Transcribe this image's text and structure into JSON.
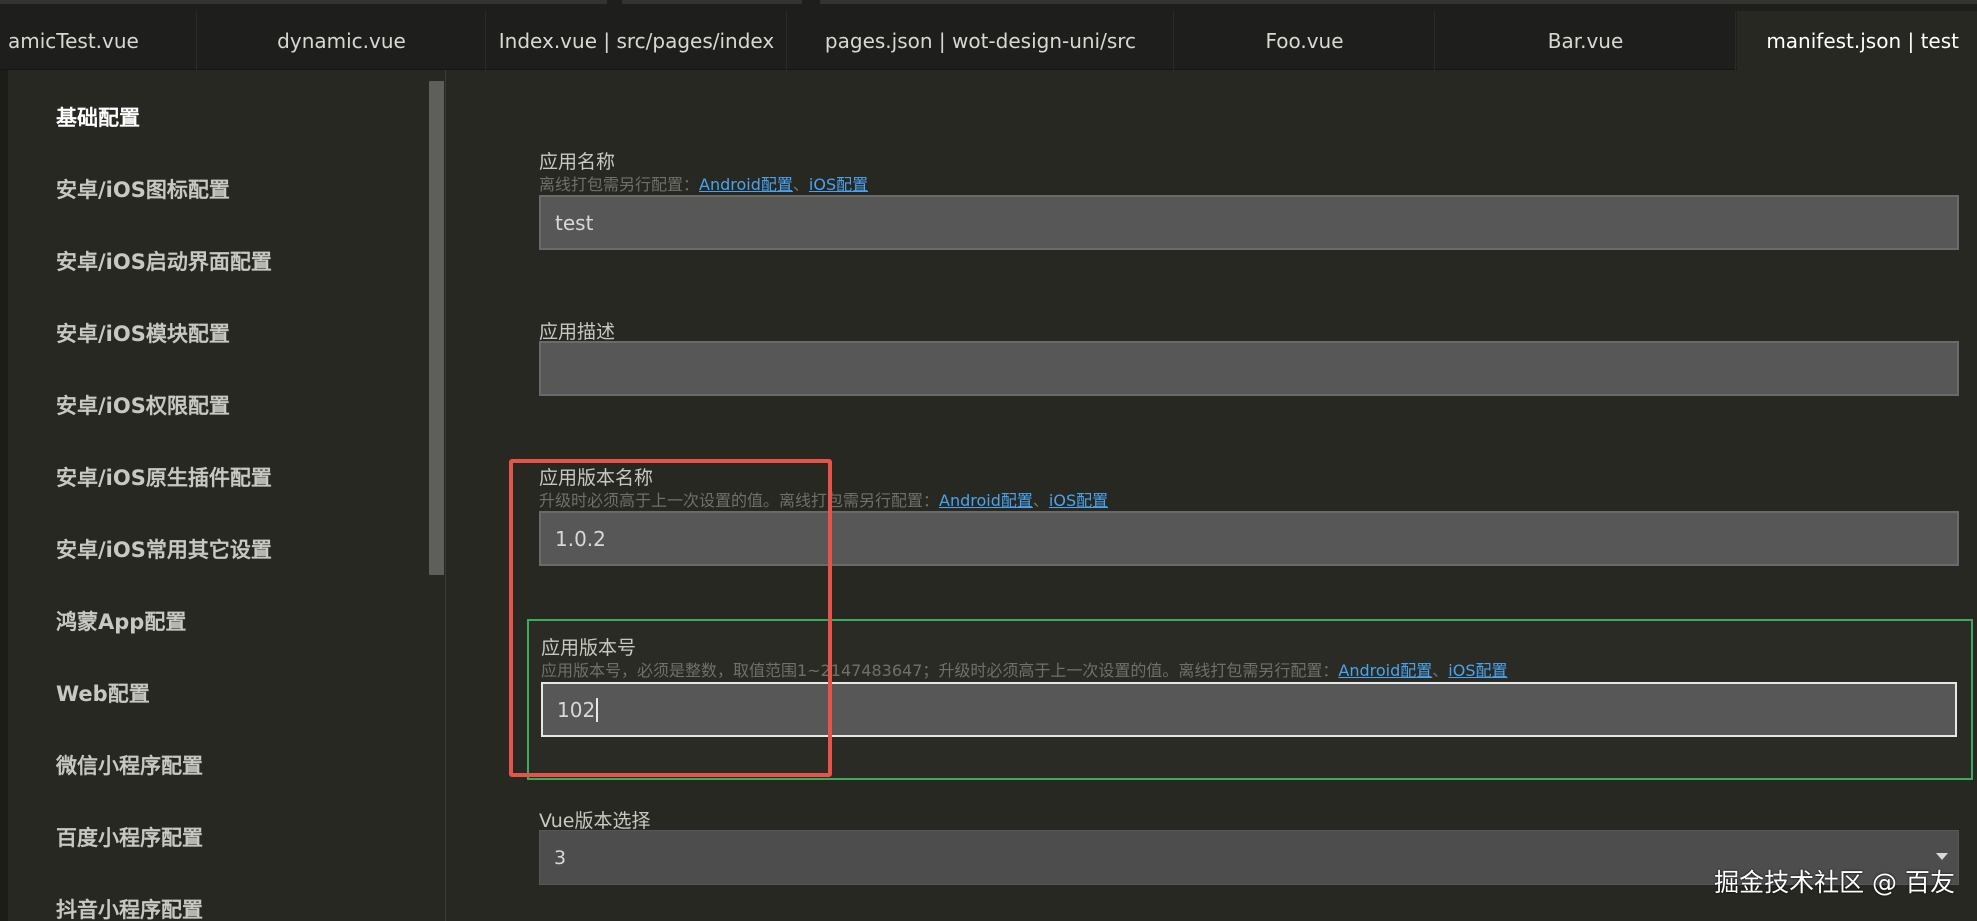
{
  "tabs": [
    {
      "label": "amicTest.vue"
    },
    {
      "label": "dynamic.vue"
    },
    {
      "label": "Index.vue | src/pages/index"
    },
    {
      "label": "pages.json | wot-design-uni/src"
    },
    {
      "label": "Foo.vue"
    },
    {
      "label": "Bar.vue"
    },
    {
      "label": "manifest.json | test"
    }
  ],
  "sidebar": {
    "items": [
      {
        "label": "基础配置"
      },
      {
        "label": "安卓/iOS图标配置"
      },
      {
        "label": "安卓/iOS启动界面配置"
      },
      {
        "label": "安卓/iOS模块配置"
      },
      {
        "label": "安卓/iOS权限配置"
      },
      {
        "label": "安卓/iOS原生插件配置"
      },
      {
        "label": "安卓/iOS常用其它设置"
      },
      {
        "label": "鸿蒙App配置"
      },
      {
        "label": "Web配置"
      },
      {
        "label": "微信小程序配置"
      },
      {
        "label": "百度小程序配置"
      },
      {
        "label": "抖音小程序配置"
      }
    ]
  },
  "form": {
    "app_name": {
      "label": "应用名称",
      "desc": "离线打包需另行配置：",
      "link_android": "Android配置",
      "sep": "、",
      "link_ios": "iOS配置",
      "value": "test"
    },
    "app_desc": {
      "label": "应用描述",
      "value": ""
    },
    "version_name": {
      "label": "应用版本名称",
      "desc": "升级时必须高于上一次设置的值。离线打包需另行配置：",
      "link_android": "Android配置",
      "sep": "、",
      "link_ios": "iOS配置",
      "value": "1.0.2"
    },
    "version_code": {
      "label": "应用版本号",
      "desc": "应用版本号，必须是整数，取值范围1~2147483647；升级时必须高于上一次设置的值。离线打包需另行配置：",
      "link_android": "Android配置",
      "sep": "、",
      "link_ios": "iOS配置",
      "value": "102"
    },
    "vue_version": {
      "label": "Vue版本选择",
      "value": "3"
    }
  },
  "watermark": "掘金技术社区 @ 百友",
  "colors": {
    "background": "#272822",
    "link": "#4aa3ee",
    "focus_border_green": "#3cab5a",
    "highlight_red": "#e5534b"
  }
}
